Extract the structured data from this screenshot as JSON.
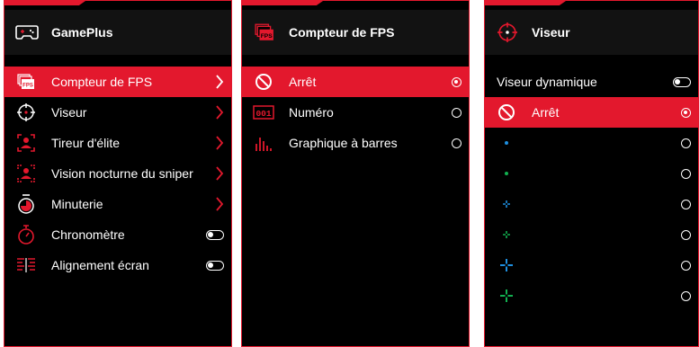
{
  "colors": {
    "accent": "#e3182d",
    "panel_bg": "#000000",
    "header_bg": "#121212",
    "text": "#ffffff"
  },
  "gameplus": {
    "title": "GamePlus",
    "icon": "gamepad-icon",
    "items": [
      {
        "label": "Compteur de FPS",
        "icon": "fps-icon",
        "control": "chevron",
        "selected": true
      },
      {
        "label": "Viseur",
        "icon": "crosshair-icon",
        "control": "chevron",
        "selected": false
      },
      {
        "label": "Tireur d'élite",
        "icon": "sniper-icon",
        "control": "chevron",
        "selected": false
      },
      {
        "label": "Vision nocturne du sniper",
        "icon": "night-sniper-icon",
        "control": "chevron",
        "selected": false
      },
      {
        "label": "Minuterie",
        "icon": "timer-icon",
        "control": "chevron",
        "selected": false
      },
      {
        "label": "Chronomètre",
        "icon": "stopwatch-icon",
        "control": "toggle",
        "toggle_on": false
      },
      {
        "label": "Alignement écran",
        "icon": "alignment-icon",
        "control": "toggle",
        "toggle_on": false
      }
    ]
  },
  "fps_counter": {
    "title": "Compteur de FPS",
    "icon": "fps-icon",
    "options": [
      {
        "label": "Arrêt",
        "icon": "off-icon",
        "selected": true
      },
      {
        "label": "Numéro",
        "icon": "number-icon",
        "badge": "001",
        "selected": false
      },
      {
        "label": "Graphique à barres",
        "icon": "bar-graph-icon",
        "selected": false
      }
    ]
  },
  "crosshair": {
    "title": "Viseur",
    "icon": "crosshair-icon",
    "dynamic": {
      "label": "Viseur dynamique",
      "toggle_on": false
    },
    "options": [
      {
        "label": "Arrêt",
        "icon": "off-icon",
        "selected": true
      },
      {
        "icon": "dot-blue-icon",
        "color": "#1e8fe0",
        "selected": false
      },
      {
        "icon": "dot-green-icon",
        "color": "#12b050",
        "selected": false
      },
      {
        "icon": "small-cross-blue-icon",
        "color": "#1e8fe0",
        "selected": false
      },
      {
        "icon": "small-cross-green-icon",
        "color": "#12b050",
        "selected": false
      },
      {
        "icon": "large-cross-blue-icon",
        "color": "#1e8fe0",
        "selected": false
      },
      {
        "icon": "large-cross-green-icon",
        "color": "#12b050",
        "selected": false
      }
    ]
  }
}
